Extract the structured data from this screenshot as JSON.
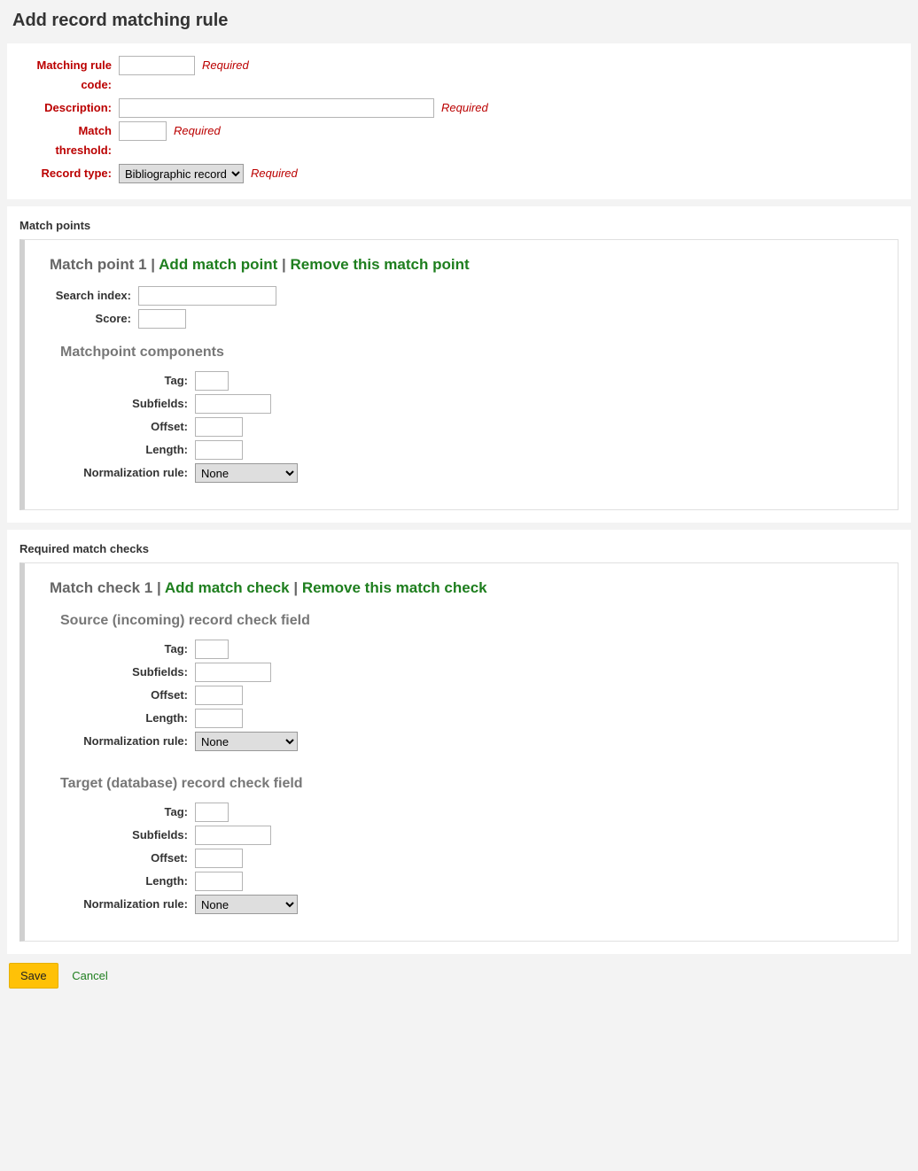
{
  "page_title": "Add record matching rule",
  "labels": {
    "matching_rule_code": "Matching rule code:",
    "description": "Description:",
    "match_threshold": "Match threshold:",
    "record_type": "Record type:",
    "required": "Required"
  },
  "record_type_options": [
    "Bibliographic record"
  ],
  "record_type_selected": "Bibliographic record",
  "match_points": {
    "heading": "Match points",
    "item_prefix": "Match point 1",
    "add_link": "Add match point",
    "remove_link": "Remove this match point",
    "search_index_label": "Search index:",
    "score_label": "Score:",
    "components_heading": "Matchpoint components",
    "tag_label": "Tag:",
    "subfields_label": "Subfields:",
    "offset_label": "Offset:",
    "length_label": "Length:",
    "norm_label": "Normalization rule:",
    "norm_options": [
      "None"
    ],
    "norm_selected": "None"
  },
  "match_checks": {
    "heading": "Required match checks",
    "item_prefix": "Match check 1",
    "add_link": "Add match check",
    "remove_link": "Remove this match check",
    "source_heading": "Source (incoming) record check field",
    "target_heading": "Target (database) record check field",
    "tag_label": "Tag:",
    "subfields_label": "Subfields:",
    "offset_label": "Offset:",
    "length_label": "Length:",
    "norm_label": "Normalization rule:",
    "norm_options": [
      "None"
    ],
    "norm_selected": "None"
  },
  "actions": {
    "save": "Save",
    "cancel": "Cancel"
  }
}
